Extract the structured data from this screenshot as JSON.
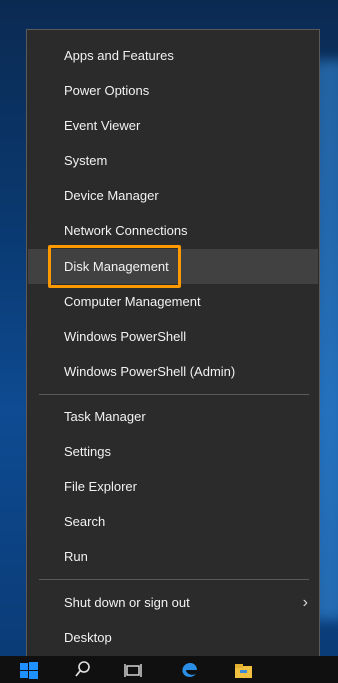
{
  "menu": {
    "items": [
      {
        "label": "Apps and Features"
      },
      {
        "label": "Power Options"
      },
      {
        "label": "Event Viewer"
      },
      {
        "label": "System"
      },
      {
        "label": "Device Manager"
      },
      {
        "label": "Network Connections"
      },
      {
        "label": "Disk Management"
      },
      {
        "label": "Computer Management"
      },
      {
        "label": "Windows PowerShell"
      },
      {
        "label": "Windows PowerShell (Admin)"
      },
      {
        "label": "Task Manager"
      },
      {
        "label": "Settings"
      },
      {
        "label": "File Explorer"
      },
      {
        "label": "Search"
      },
      {
        "label": "Run"
      },
      {
        "label": "Shut down or sign out"
      },
      {
        "label": "Desktop"
      }
    ],
    "highlighted_item": "Disk Management",
    "submenu_arrow": "›"
  },
  "taskbar": {
    "icons": [
      "windows-start-icon",
      "search-icon",
      "task-view-icon",
      "edge-browser-icon",
      "file-explorer-icon"
    ]
  },
  "colors": {
    "menu_background": "#2b2b2b",
    "menu_text": "#f2f2f2",
    "hover_background": "#414141",
    "highlight_border": "#ff9900",
    "windows_blue": "#1e90ff"
  }
}
